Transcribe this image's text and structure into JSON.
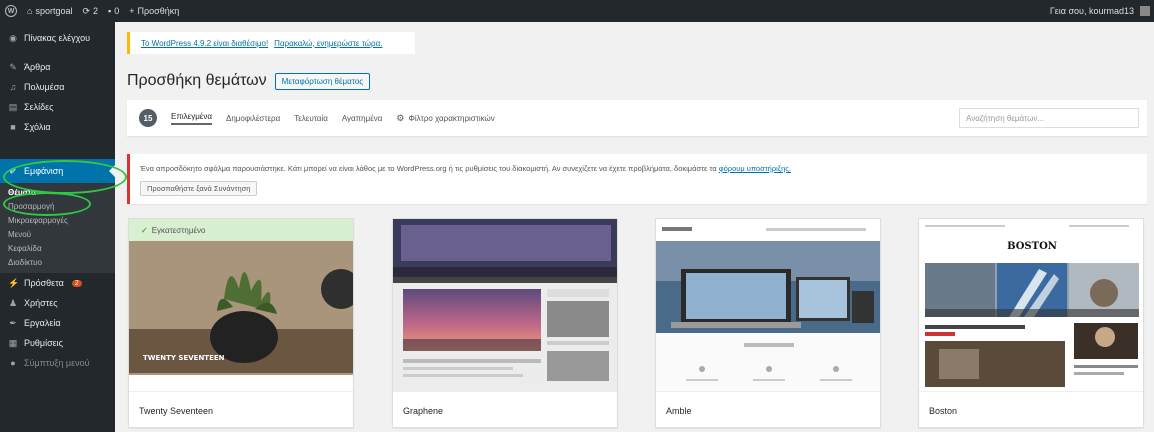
{
  "adminbar": {
    "site_name": "sportgoal",
    "updates_count": "2",
    "comments_count": "0",
    "new_label": "Προσθήκη",
    "howdy": "Γεια σου, kourmad13"
  },
  "sidebar": {
    "items": [
      {
        "label": "Πίνακας ελέγχου",
        "icon": "dashboard-icon"
      },
      {
        "label": "Άρθρα",
        "icon": "pin-icon"
      },
      {
        "label": "Πολυμέσα",
        "icon": "media-icon"
      },
      {
        "label": "Σελίδες",
        "icon": "pages-icon"
      },
      {
        "label": "Σχόλια",
        "icon": "comments-icon"
      }
    ],
    "current": {
      "label": "Εμφάνιση",
      "icon": "appearance-icon"
    },
    "submenu": [
      "Θέματα",
      "Προσαρμογή",
      "Μικροεφαρμογές",
      "Μενού",
      "Κεφαλίδα",
      "Διαδίκτυο"
    ],
    "items_after": [
      {
        "label": "Πρόσθετα",
        "icon": "plugins-icon",
        "badge": "2"
      },
      {
        "label": "Χρήστες",
        "icon": "users-icon"
      },
      {
        "label": "Εργαλεία",
        "icon": "tools-icon"
      },
      {
        "label": "Ρυθμίσεις",
        "icon": "settings-icon"
      },
      {
        "label": "Σύμπτυξη μενού",
        "icon": "collapse-icon"
      }
    ]
  },
  "update_notice": {
    "prefix": "Το WordPress 4.9.2 είναι διαθέσιμο!",
    "link": "Παρακαλώ, ενημερώστε τώρα."
  },
  "page": {
    "title": "Προσθήκη θεμάτων",
    "upload_label": "Μεταφόρτωση θέματος"
  },
  "filters": {
    "count": "15",
    "tabs": [
      "Επιλεγμένα",
      "Δημοφιλέστερα",
      "Τελευταία",
      "Αγαπημένα"
    ],
    "feature_filter": "Φίλτρο χαρακτηριστικών",
    "search_placeholder": "Αναζήτηση θεμάτων..."
  },
  "error_notice": {
    "text": "Ένα απροσδόκητο σφάλμα παρουσιάστηκε. Κάτι μπορεί να είναι λάθος με το WordPress.org ή τις ρυθμίσεις του διακομιστή. Αν συνεχίζετε να έχετε προβλήματα, δοκιμάστε τα",
    "link": "φόρουμ υποστήριξης.",
    "button": "Προσπαθήστε ξανά Συνάντηση"
  },
  "themes": [
    {
      "name": "Twenty Seventeen",
      "active_label": "Εγκατεστημένο"
    },
    {
      "name": "Graphene"
    },
    {
      "name": "Amble"
    },
    {
      "name": "Boston",
      "header_text": "BOSTON"
    }
  ],
  "theme_previews": {
    "twenty_seventeen_overlay": "TWENTY SEVENTEEN"
  },
  "colors": {
    "adminbar_bg": "#23282d",
    "accent": "#0073aa",
    "highlight_ellipse": "#2ec845",
    "error": "#dc3232",
    "warning": "#ffb900"
  }
}
